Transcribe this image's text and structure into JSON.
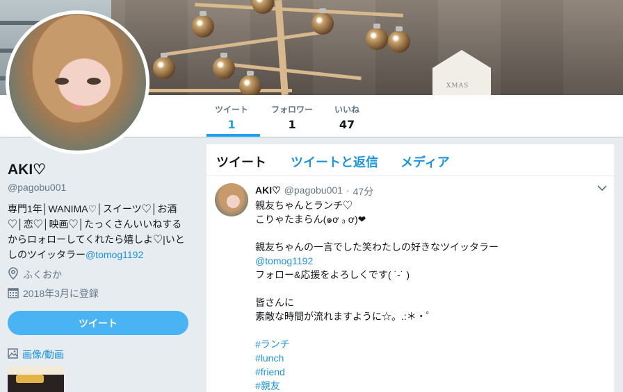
{
  "profile": {
    "name": "AKI♡",
    "handle": "@pagobu001",
    "bio_text": "専門1年│WANIMA♡│スイーツ♡│お酒♡│恋♡│映画♡│たっくさんいいねするからロォローしてくれたら嬉しよ♡|いとしのツイッタラー",
    "bio_mention": "@tomog1192",
    "location": "ふくおか",
    "joined": "2018年3月に登録",
    "tweet_button": "ツイート",
    "media_link": "画像/動画"
  },
  "stats": [
    {
      "label": "ツイート",
      "value": "1"
    },
    {
      "label": "フォロワー",
      "value": "1"
    },
    {
      "label": "いいね",
      "value": "47"
    }
  ],
  "timeline": {
    "tabs": [
      "ツイート",
      "ツイートと返信",
      "メディア"
    ],
    "tweet": {
      "name": "AKI♡",
      "handle": "@pagobu001",
      "sep": "·",
      "time": "47分",
      "lines": [
        {
          "text": "親友ちゃんとランチ♡",
          "link": false
        },
        {
          "text": "こりゃたまらん(๑ơ ₃ ơ)❤",
          "link": false
        },
        {
          "text": "",
          "link": false
        },
        {
          "text": "親友ちゃんの一言でした笑わたしの好きなツイッタラー",
          "link": false
        },
        {
          "text": "@tomog1192",
          "link": true
        },
        {
          "text": "フォロー&応援をよろしくです( ˙-˙ )",
          "link": false
        },
        {
          "text": "",
          "link": false
        },
        {
          "text": "皆さんに",
          "link": false
        },
        {
          "text": "素敵な時間が流れますように☆。.:＊・゜",
          "link": false
        },
        {
          "text": "",
          "link": false
        },
        {
          "text": "#ランチ",
          "link": true
        },
        {
          "text": "#lunch",
          "link": true
        },
        {
          "text": "#friend",
          "link": true
        },
        {
          "text": "#親友",
          "link": true
        }
      ]
    }
  },
  "icons": [
    "location-icon",
    "calendar-icon",
    "image-icon",
    "chevron-down-icon"
  ],
  "colors": {
    "accent": "#1da1f2",
    "link": "#1b95e0",
    "button": "#4ab3f4",
    "background": "#e6ecf0"
  }
}
